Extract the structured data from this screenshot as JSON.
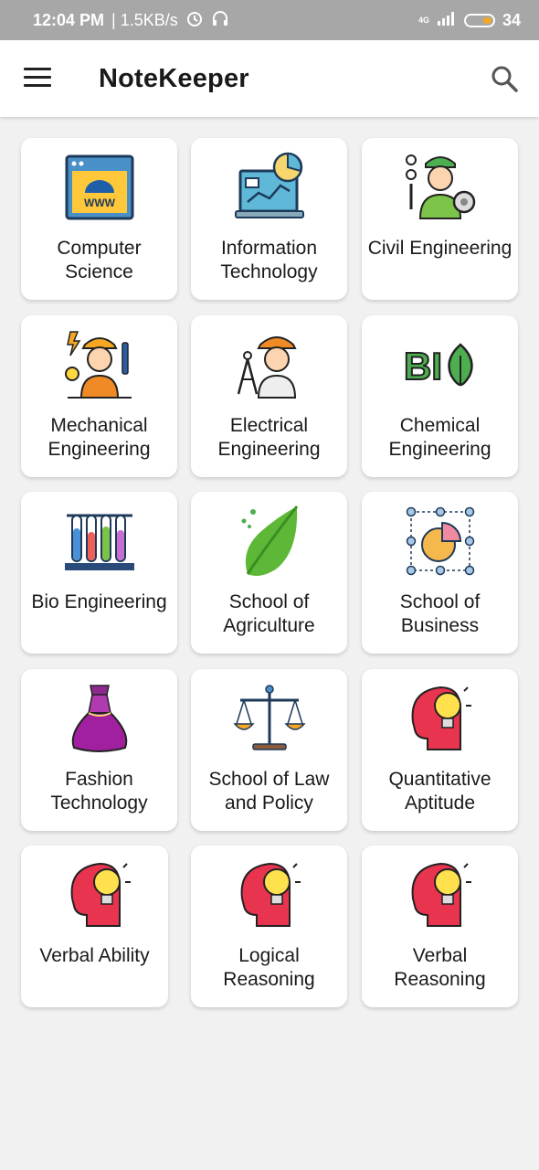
{
  "status_bar": {
    "time": "12:04 PM",
    "speed": "| 1.5KB/s",
    "network": "4G",
    "battery": "34"
  },
  "app_bar": {
    "title": "NoteKeeper",
    "menu_icon": "hamburger-menu-icon",
    "search_icon": "search-icon"
  },
  "cards": [
    {
      "label": "Computer Science",
      "icon": "web-browser-icon"
    },
    {
      "label": "Information Technology",
      "icon": "laptop-analytics-icon"
    },
    {
      "label": "Civil Engineering",
      "icon": "engineer-worker-icon"
    },
    {
      "label": "Mechanical Engineering",
      "icon": "electrician-worker-icon"
    },
    {
      "label": "Electrical Engineering",
      "icon": "engineer-compass-icon"
    },
    {
      "label": "Chemical Engineering",
      "icon": "bio-leaf-icon"
    },
    {
      "label": "Bio Engineering",
      "icon": "test-tubes-icon"
    },
    {
      "label": "School of Agriculture",
      "icon": "leaf-icon"
    },
    {
      "label": "School of Business",
      "icon": "pie-chart-icon"
    },
    {
      "label": "Fashion Technology",
      "icon": "dress-icon"
    },
    {
      "label": "School of Law and Policy",
      "icon": "justice-scale-icon"
    },
    {
      "label": "Quantitative Aptitude",
      "icon": "head-lightbulb-icon"
    },
    {
      "label": "Verbal Ability",
      "icon": "head-lightbulb-icon"
    },
    {
      "label": "Logical Reasoning",
      "icon": "head-lightbulb-icon"
    },
    {
      "label": "Verbal Reasoning",
      "icon": "head-lightbulb-icon"
    }
  ],
  "colors": {
    "status_bar": "#a7a7a7",
    "app_bar": "#ffffff",
    "background": "#f1f1f1",
    "card": "#ffffff"
  }
}
